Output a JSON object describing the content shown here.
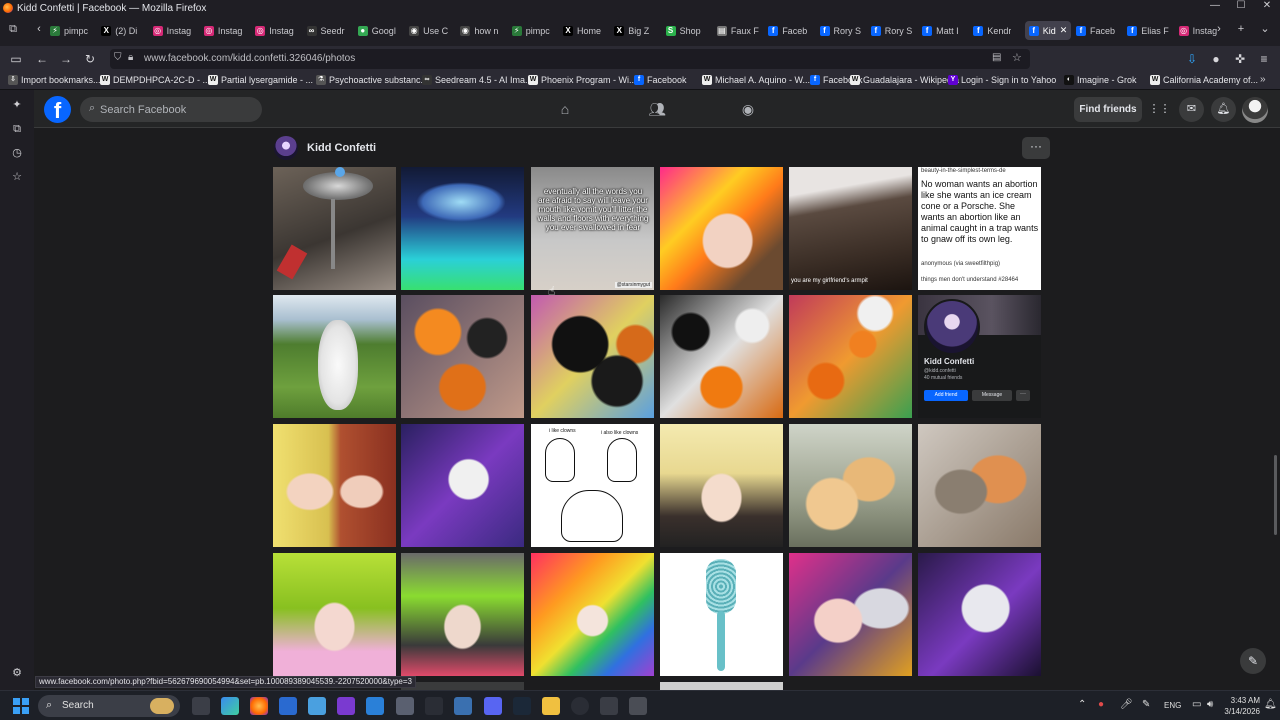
{
  "window": {
    "title": "Kidd Confetti | Facebook — Mozilla Firefox"
  },
  "tabs": [
    {
      "label": "pimpc",
      "icon": "bolt-icon"
    },
    {
      "label": "(2) Di",
      "icon": "x-icon"
    },
    {
      "label": "Instag",
      "icon": "instagram-icon"
    },
    {
      "label": "Instag",
      "icon": "instagram-icon"
    },
    {
      "label": "Instag",
      "icon": "instagram-icon"
    },
    {
      "label": "Seedr",
      "icon": "seedream-icon"
    },
    {
      "label": "Googl",
      "icon": "maps-pin-icon"
    },
    {
      "label": "Use C",
      "icon": "chatgpt-icon"
    },
    {
      "label": "how n",
      "icon": "chatgpt-icon"
    },
    {
      "label": "pimpc",
      "icon": "bolt-icon"
    },
    {
      "label": "Home",
      "icon": "x-icon"
    },
    {
      "label": "Big Z",
      "icon": "x-icon"
    },
    {
      "label": "Shop",
      "icon": "shopify-icon"
    },
    {
      "label": "Faux F",
      "icon": "doc-icon"
    },
    {
      "label": "Faceb",
      "icon": "facebook-icon"
    },
    {
      "label": "Rory S",
      "icon": "facebook-icon"
    },
    {
      "label": "Rory S",
      "icon": "facebook-icon"
    },
    {
      "label": "Matt I",
      "icon": "facebook-icon"
    },
    {
      "label": "Kendr",
      "icon": "facebook-icon"
    },
    {
      "label": "Kid",
      "icon": "facebook-icon",
      "active": true
    },
    {
      "label": "Faceb",
      "icon": "facebook-icon"
    },
    {
      "label": "Elias F",
      "icon": "facebook-icon"
    },
    {
      "label": "Instag",
      "icon": "instagram-icon"
    }
  ],
  "urlbar": {
    "url": "www.facebook.com/kidd.confetti.326046/photos"
  },
  "bookmarks": [
    {
      "label": "Import bookmarks...",
      "icon": "import-icon"
    },
    {
      "label": "DEMPDHPCA-2C-D - ...",
      "icon": "wiki-icon"
    },
    {
      "label": "Partial lysergamide - ...",
      "icon": "wiki-icon"
    },
    {
      "label": "Psychoactive substanc...",
      "icon": "flask-icon"
    },
    {
      "label": "Seedream 4.5 - AI Ima...",
      "icon": "seedream-icon"
    },
    {
      "label": "Phoenix Program - Wi...",
      "icon": "wiki-icon"
    },
    {
      "label": "Facebook",
      "icon": "facebook-icon"
    },
    {
      "label": "Michael A. Aquino - W...",
      "icon": "wiki-icon"
    },
    {
      "label": "Facebook",
      "icon": "facebook-icon"
    },
    {
      "label": "Guadalajara - Wikipedia",
      "icon": "wiki-icon"
    },
    {
      "label": "Login - Sign in to Yahoo",
      "icon": "yahoo-icon"
    },
    {
      "label": "Imagine - Grok",
      "icon": "grok-icon"
    },
    {
      "label": "California Academy of...",
      "icon": "wiki-icon"
    }
  ],
  "facebook": {
    "search_placeholder": "Search Facebook",
    "find_friends": "Find friends",
    "profile_name": "Kidd Confetti"
  },
  "photos": {
    "captions": {
      "words_quote": "eventually all the words you are afraid to say will leave your mouth like vomit you'll litter the walls and floors with everything you ever swallowed in fear",
      "words_handle": "@starsinmygut",
      "armpit": "you are my girlfriend's armpit",
      "abortion_head": "beauty-in-the-simplest-terms-de",
      "abortion_body": "No woman wants an abortion like she wants an ice cream cone or a Porsche. She wants an abortion like an animal caught in a trap wants to gnaw off its own leg.",
      "abortion_credit": "anonymous (via sweetfilthpig)",
      "abortion_foot": "things men don't understand #28464",
      "profile_card_name": "Kidd Confetti",
      "profile_card_handle": "@kidd.confetti",
      "profile_card_mutual": "40 mutual friends",
      "profile_card_add": "Add friend",
      "profile_card_message": "Message",
      "clowns_left": "i like clowns",
      "clowns_right": "i also like clowns"
    }
  },
  "status": {
    "hover_url": "www.facebook.com/photo.php?fbid=562679690054994&set=pb.100089389045539.-2207520000&type=3"
  },
  "taskbar": {
    "search_label": "Search",
    "lang": "ENG",
    "time": "3:43 AM",
    "date": "3/14/2026"
  },
  "colors": {
    "fb_blue": "#0866ff",
    "fb_bg": "#1c1c1e",
    "fb_header": "#242526"
  }
}
